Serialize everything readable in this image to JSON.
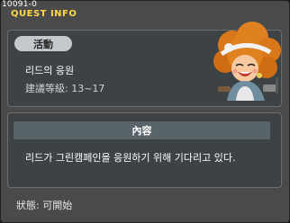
{
  "window": {
    "id": "10091-0",
    "title": "QUEST INFO"
  },
  "quest": {
    "badge": "活動",
    "name": "리드의 응원",
    "level": "建議等級: 13~17"
  },
  "content": {
    "header": "內容",
    "text": "리드가 그린캠페인을 응원하기 위해 기다리고 있다."
  },
  "status": {
    "text": "狀態:  可開始"
  },
  "colors": {
    "title": "#ffd84a",
    "panel": "#3d4245",
    "hair": "#d9771b"
  },
  "icons": {
    "portrait": "npc-reed-portrait"
  }
}
